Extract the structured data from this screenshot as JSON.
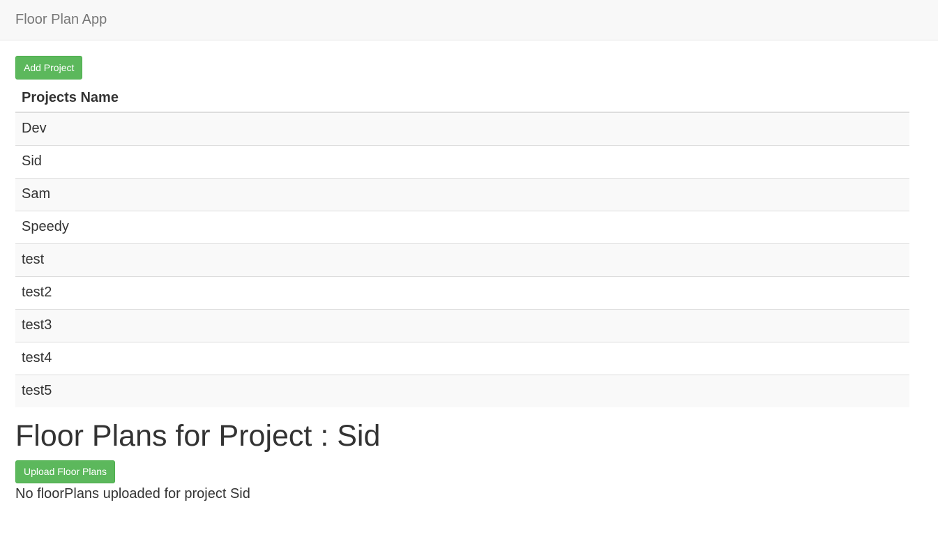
{
  "navbar": {
    "brand": "Floor Plan App"
  },
  "toolbar": {
    "add_project_label": "Add Project"
  },
  "projects_table": {
    "header": "Projects Name",
    "rows": [
      "Dev",
      "Sid",
      "Sam",
      "Speedy",
      "test",
      "test2",
      "test3",
      "test4",
      "test5"
    ]
  },
  "floor_plans": {
    "heading": "Floor Plans for Project : Sid",
    "upload_label": "Upload Floor Plans",
    "empty_message": "No floorPlans uploaded for project Sid"
  },
  "colors": {
    "accent_green": "#5cb85c",
    "navbar_bg": "#f8f8f8"
  }
}
